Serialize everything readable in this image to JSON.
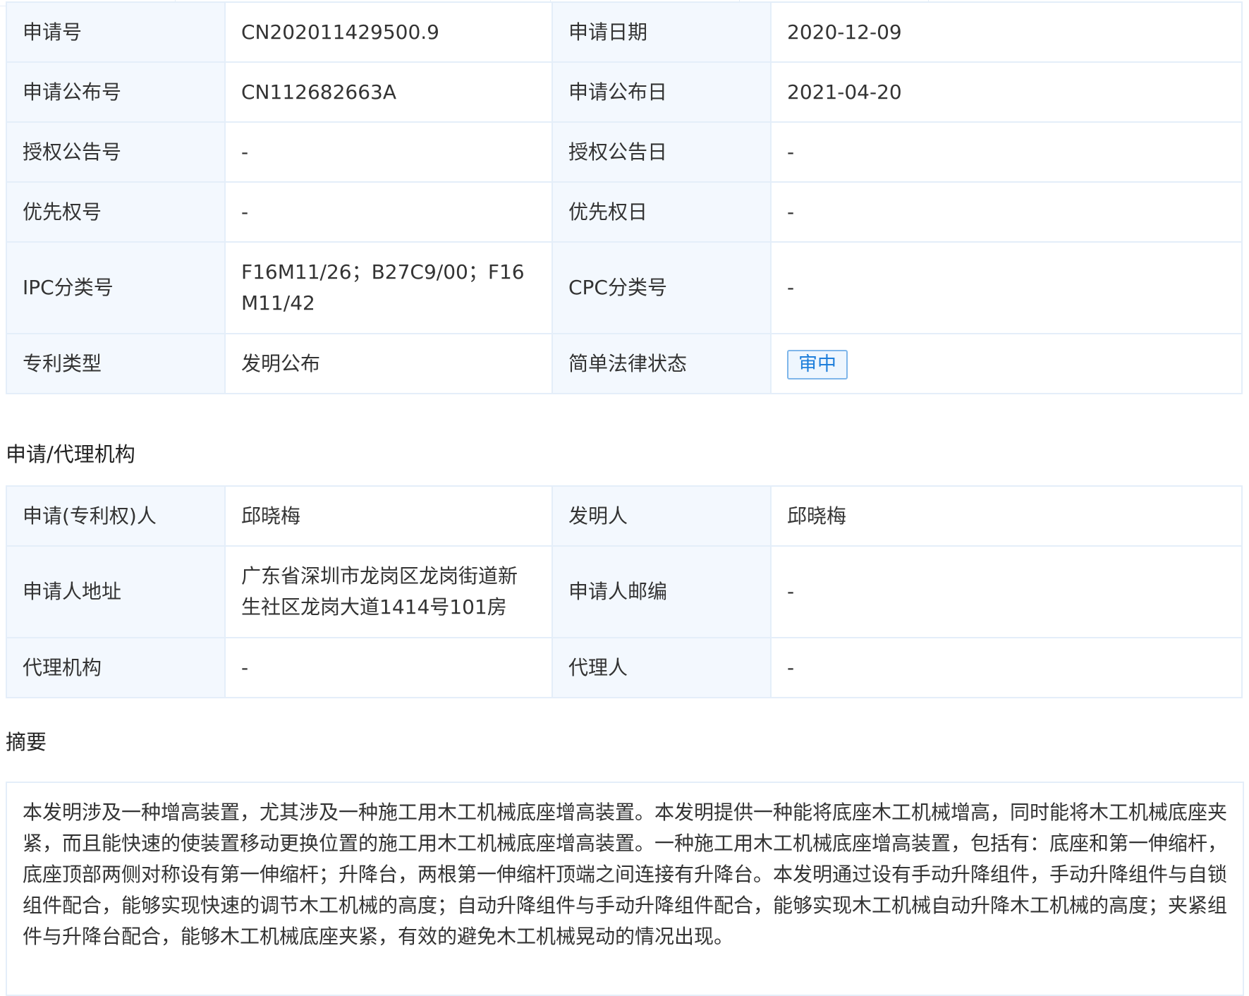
{
  "basic_info": {
    "rows": [
      {
        "l1": "申请号",
        "v1": "CN202011429500.9",
        "l2": "申请日期",
        "v2": "2020-12-09"
      },
      {
        "l1": "申请公布号",
        "v1": "CN112682663A",
        "l2": "申请公布日",
        "v2": "2021-04-20"
      },
      {
        "l1": "授权公告号",
        "v1": "-",
        "l2": "授权公告日",
        "v2": "-"
      },
      {
        "l1": "优先权号",
        "v1": "-",
        "l2": "优先权日",
        "v2": "-"
      },
      {
        "l1": "IPC分类号",
        "v1": "F16M11/26；B27C9/00；F16M11/42",
        "l2": "CPC分类号",
        "v2": "-"
      },
      {
        "l1": "专利类型",
        "v1": "发明公布",
        "l2": "简单法律状态",
        "v2": "审中"
      }
    ]
  },
  "agency": {
    "title": "申请/代理机构",
    "rows": [
      {
        "l1": "申请(专利权)人",
        "v1": "邱晓梅",
        "l2": "发明人",
        "v2": "邱晓梅"
      },
      {
        "l1": "申请人地址",
        "v1": "广东省深圳市龙岗区龙岗街道新生社区龙岗大道1414号101房",
        "l2": "申请人邮编",
        "v2": "-"
      },
      {
        "l1": "代理机构",
        "v1": "-",
        "l2": "代理人",
        "v2": "-"
      }
    ]
  },
  "abstract": {
    "title": "摘要",
    "text": "本发明涉及一种增高装置，尤其涉及一种施工用木工机械底座增高装置。本发明提供一种能将底座木工机械增高，同时能将木工机械底座夹紧，而且能快速的使装置移动更换位置的施工用木工机械底座增高装置。一种施工用木工机械底座增高装置，包括有：底座和第一伸缩杆，底座顶部两侧对称设有第一伸缩杆；升降台，两根第一伸缩杆顶端之间连接有升降台。本发明通过设有手动升降组件，手动升降组件与自锁组件配合，能够实现快速的调节木工机械的高度；自动升降组件与手动升降组件配合，能够实现木工机械自动升降木工机械的高度；夹紧组件与升降台配合，能够木工机械底座夹紧，有效的避免木工机械晃动的情况出现。"
  },
  "colors": {
    "label_bg": "#f3f8fe",
    "border": "#e4eef9",
    "badge_text": "#1f7fdb",
    "badge_border": "#7fb6ea"
  }
}
